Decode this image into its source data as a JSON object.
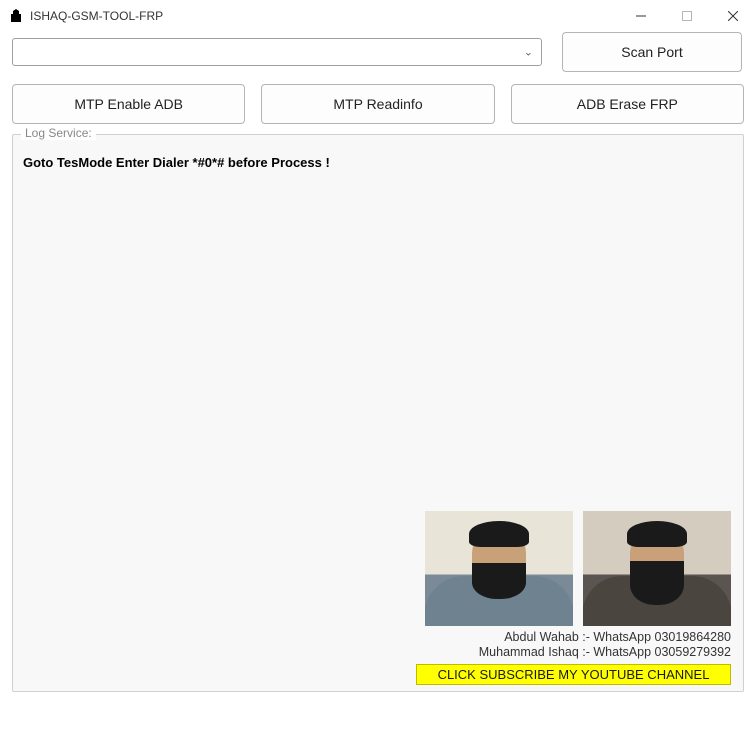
{
  "window": {
    "icon_label": "KING",
    "title": "ISHAQ-GSM-TOOL-FRP"
  },
  "toolbar": {
    "scan_port": "Scan Port",
    "mtp_enable_adb": "MTP Enable ADB",
    "mtp_readinfo": "MTP Readinfo",
    "adb_erase_frp": "ADB Erase FRP"
  },
  "combo": {
    "selected": ""
  },
  "log_service": {
    "legend": "Log Service:",
    "message": "Goto TesMode Enter Dialer *#0*# before Process !"
  },
  "footer": {
    "contact1": "Abdul Wahab :- WhatsApp 03019864280",
    "contact2": "Muhammad Ishaq :- WhatsApp 03059279392",
    "youtube": "CLICK SUBSCRIBE MY YOUTUBE CHANNEL"
  }
}
